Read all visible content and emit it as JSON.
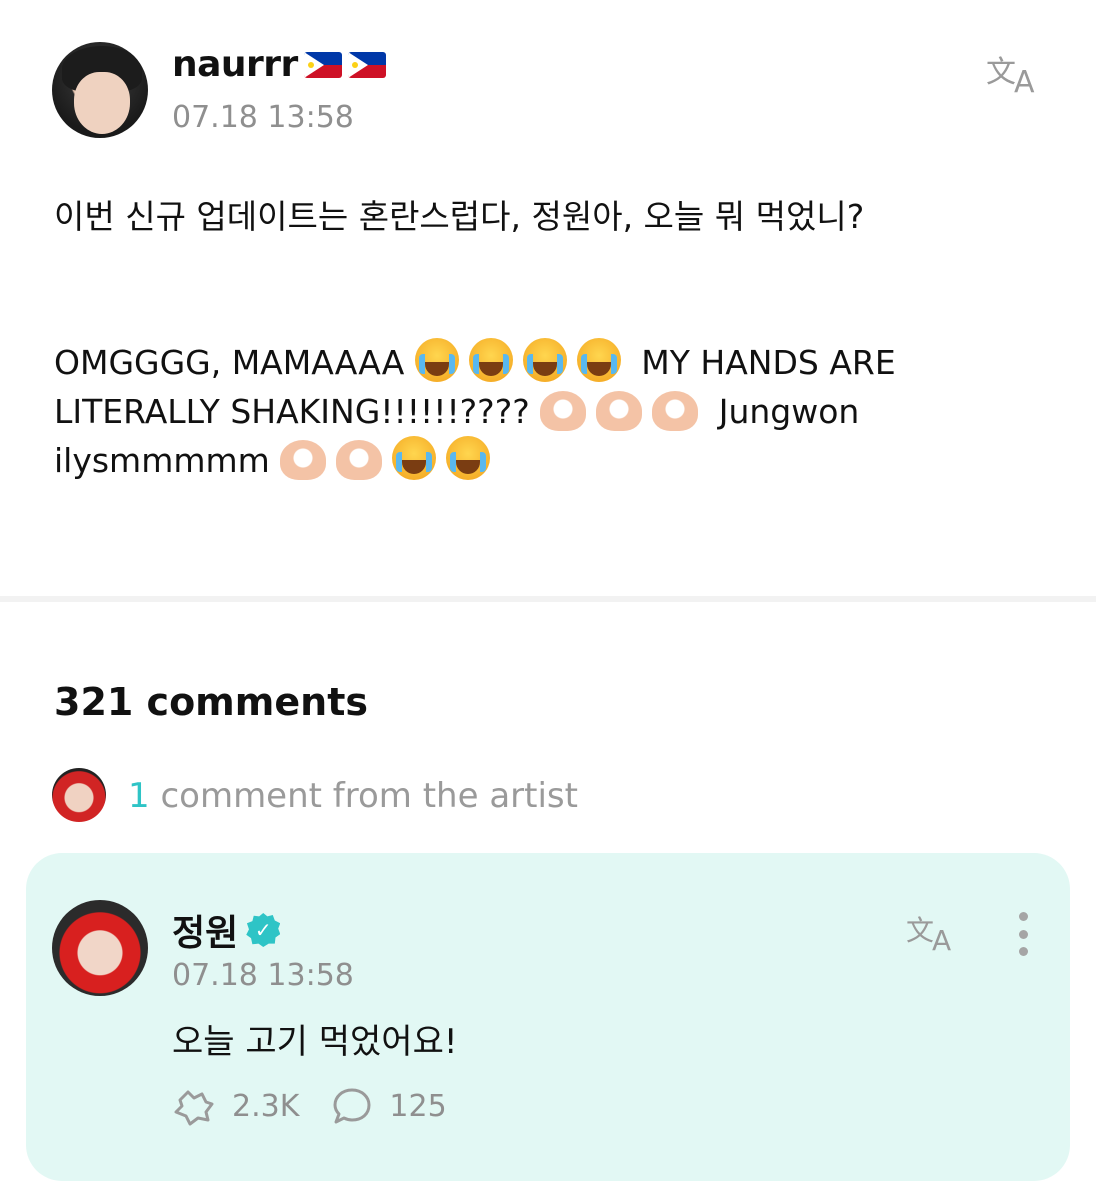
{
  "post": {
    "username": "naurrr",
    "username_flags": [
      "ph-flag-icon",
      "ph-flag-icon"
    ],
    "timestamp": "07.18 13:58",
    "text_korean": "이번 신규 업데이트는 혼란스럽다, 정원아, 오늘 뭐 먹었니?",
    "text_segments": {
      "a": "OMGGGG, MAMAAAA ",
      "b": " MY HANDS ARE LITERALLY SHAKING!!!!!!???? ",
      "c": " Jungwon ilysmmmmm "
    }
  },
  "comments_header": {
    "count_label": "321 comments"
  },
  "artist_comments": {
    "count": "1",
    "label": " comment from the artist"
  },
  "artist_comment": {
    "name": "정원",
    "timestamp": "07.18 13:58",
    "text": "오늘 고기 먹었어요!",
    "likes": "2.3K",
    "replies": "125"
  },
  "colors": {
    "accent": "#2ec4c6",
    "card_bg": "#e2f8f4",
    "muted_text": "#8f8f8f"
  }
}
